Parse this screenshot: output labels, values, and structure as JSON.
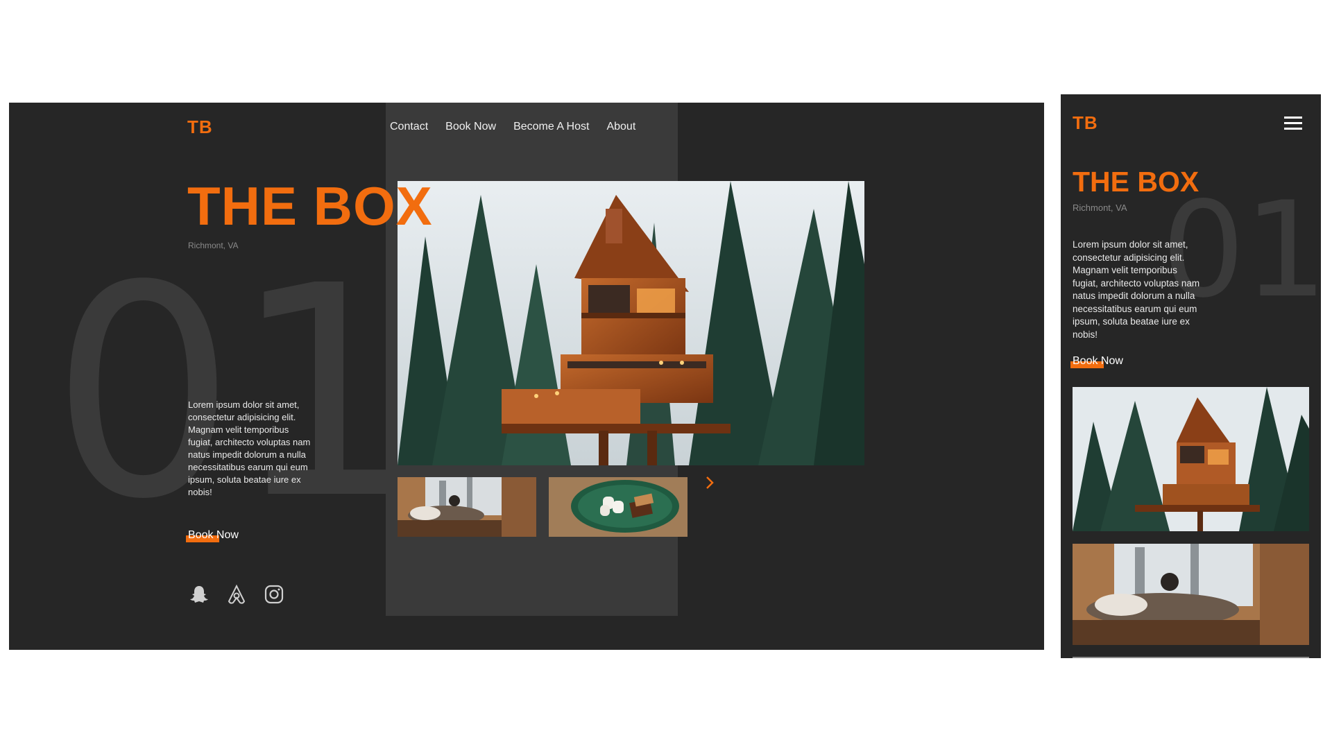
{
  "brand": {
    "logo": "TB",
    "accent": "#f26d0f",
    "background": "#262626",
    "panel": "#3a3a3a"
  },
  "desktop": {
    "nav": [
      "Contact",
      "Book Now",
      "Become A Host",
      "About"
    ],
    "number": "01",
    "title": "THE BOX",
    "location": "Richmont, VA",
    "description": "Lorem ipsum dolor sit amet, consectetur adipisicing elit. Magnam velit temporibus fugiat, architecto voluptas nam natus impedit dolorum a nulla necessitatibus earum qui eum ipsum, soluta beatae iure ex nobis!",
    "book_now": "Book Now",
    "social_icons": [
      "snapchat-icon",
      "airbnb-icon",
      "instagram-icon"
    ],
    "next_icon": "chevron-right-icon"
  },
  "mobile": {
    "logo": "TB",
    "menu_icon": "hamburger-menu-icon",
    "number": "01",
    "title": "THE BOX",
    "location": "Richmont, VA",
    "description": "Lorem ipsum dolor sit amet, consectetur adipisicing elit. Magnam velit temporibus fugiat, architecto voluptas nam natus impedit dolorum a nulla necessitatibus earum qui eum ipsum, soluta beatae iure ex nobis!",
    "book_now": "Book Now"
  }
}
